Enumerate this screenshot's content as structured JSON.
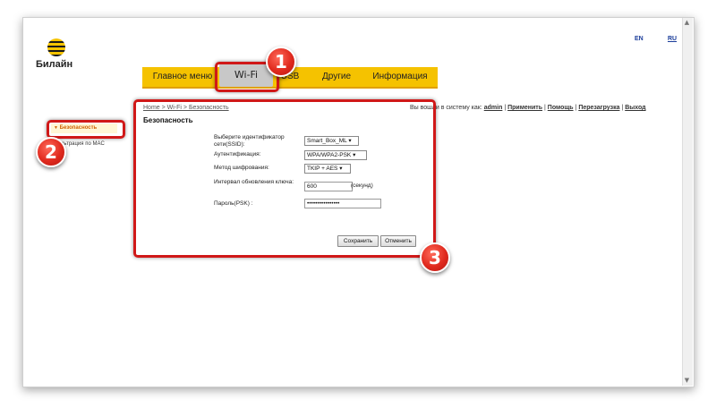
{
  "brand": {
    "name": "Билайн"
  },
  "languages": {
    "en": "EN",
    "ru": "RU"
  },
  "menu": {
    "main": "Главное меню",
    "wifi": "Wi-Fi",
    "usb": "USB",
    "other": "Другие",
    "info": "Информация"
  },
  "sidebar": {
    "items": [
      {
        "label": "Безопасность"
      },
      {
        "label": "Фильтрация по MAC"
      }
    ]
  },
  "breadcrumb": "Home > Wi-Fi > Безопасность",
  "session": {
    "prefix": "Вы вошли в систему как:",
    "user": "admin",
    "apply": "Применить",
    "help": "Помощь",
    "reboot": "Перезагрузка",
    "logout": "Выход",
    "sep": "|"
  },
  "form": {
    "title": "Безопасность",
    "ssid_label": "Выберите идентификатор сети(SSID):",
    "ssid_value": "Smart_Box_ML",
    "auth_label": "Аутентификация:",
    "auth_value": "WPA/WPA2-PSK",
    "enc_label": "Метод шифрования:",
    "enc_value": "TKIP + AES",
    "interval_label": "Интервал обновления ключа:",
    "interval_value": "600",
    "interval_unit": "(секунд)",
    "psk_label": "Пароль(PSK) :",
    "psk_value": "••••••••••••••••",
    "save": "Сохранить",
    "cancel": "Отменить"
  },
  "annotations": {
    "one": "1",
    "two": "2",
    "three": "3"
  },
  "colors": {
    "menu_bg": "#f5c200",
    "highlight": "#d01818",
    "link": "#1a3c9a"
  }
}
